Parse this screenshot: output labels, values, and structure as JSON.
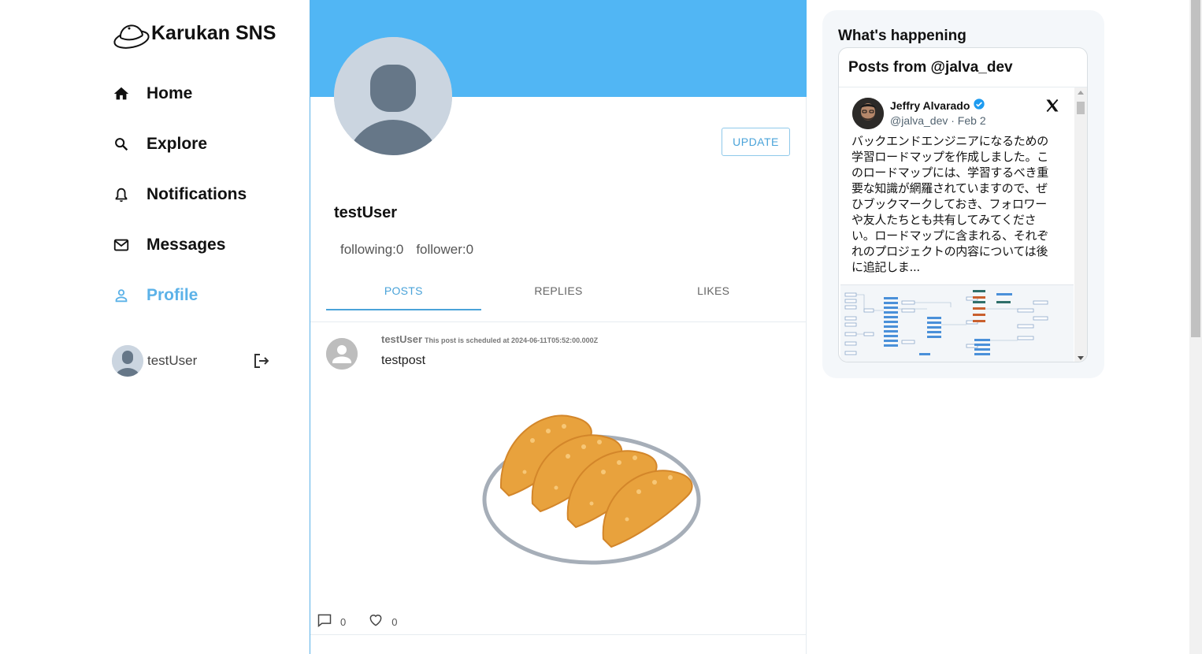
{
  "app": {
    "name": "Karukan SNS"
  },
  "sidebar": {
    "items": [
      {
        "label": "Home",
        "icon": "home-icon"
      },
      {
        "label": "Explore",
        "icon": "search-icon"
      },
      {
        "label": "Notifications",
        "icon": "bell-icon"
      },
      {
        "label": "Messages",
        "icon": "mail-icon"
      },
      {
        "label": "Profile",
        "icon": "person-icon",
        "active": true
      }
    ],
    "user": {
      "name": "testUser"
    }
  },
  "profile": {
    "update_label": "UPDATE",
    "name": "testUser",
    "following": "following:0",
    "follower": "follower:0",
    "tabs": [
      {
        "label": "POSTS",
        "active": true
      },
      {
        "label": "REPLIES"
      },
      {
        "label": "LIKES"
      }
    ]
  },
  "post": {
    "user": "testUser",
    "scheduled": "This post is scheduled at 2024-06-11T05:52:00.000Z",
    "text": "testpost",
    "comment_count": "0",
    "like_count": "0"
  },
  "right_panel": {
    "title": "What's happening",
    "embed_header": "Posts from @jalva_dev",
    "tweet": {
      "name": "Jeffry Alvarado",
      "handle_date": "@jalva_dev · Feb 2",
      "text": "バックエンドエンジニアになるための学習ロードマップを作成しました。このロードマップには、学習するべき重要な知識が網羅されていますので、ぜひブックマークしておき、フォロワーや友人たちとも共有してみてください。ロードマップに含まれる、それぞれのプロジェクトの内容については後に追記しま..."
    }
  },
  "colors": {
    "accent": "#5cb2e8",
    "banner": "#51b6f4",
    "verified": "#1d9bf0"
  }
}
